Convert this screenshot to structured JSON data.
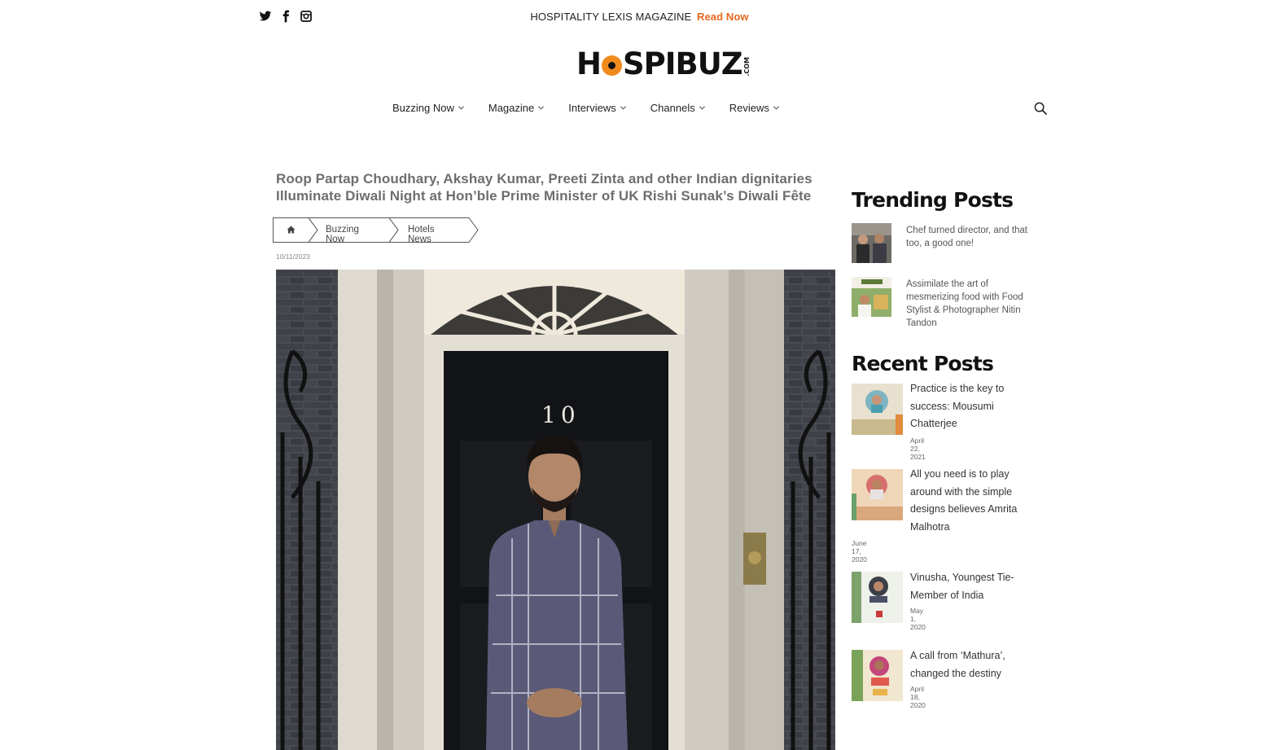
{
  "topbar": {
    "social_icons": [
      "twitter-icon",
      "facebook-icon",
      "instagram-icon"
    ],
    "promo_text": "HOSPITALITY LEXIS MAGAZINE",
    "promo_link": "Read Now"
  },
  "logo": {
    "text_before": "H",
    "text_after": "SPIBUZ",
    "suffix": ".COM"
  },
  "nav": {
    "items": [
      {
        "label": "Buzzing Now"
      },
      {
        "label": "Magazine"
      },
      {
        "label": "Interviews"
      },
      {
        "label": "Channels"
      },
      {
        "label": "Reviews"
      }
    ],
    "search_icon": "search-icon"
  },
  "article": {
    "title": "Roop Partap Choudhary, Akshay Kumar, Preeti Zinta and other Indian dignitaries Illuminate Diwali Night at Hon’ble Prime Minister of UK Rishi Sunak’s Diwali Fête",
    "breadcrumb": {
      "home_icon": "home-icon",
      "items": [
        "Buzzing Now",
        "Hotels News"
      ]
    },
    "date": "10/11/2023",
    "door_number": "10"
  },
  "sidebar": {
    "trending_title": "Trending Posts",
    "trending": [
      {
        "text": "Chef turned director, and that too, a good one!"
      },
      {
        "text": "Assimilate the art of mesmerizing food with Food Stylist & Photographer Nitin Tandon"
      }
    ],
    "recent_title": "Recent Posts",
    "recent": [
      {
        "text": "Practice is the key to success: Mousumi Chatterjee",
        "date": "April 22, 2021"
      },
      {
        "text": "All you need is to play around with the simple designs believes Amrita Malhotra",
        "date": "June 17, 2020"
      },
      {
        "text": "Vinusha, Youngest Tie-Member of India",
        "date": "May 1, 2020"
      },
      {
        "text": "A call from ‘Mathura’, changed the destiny",
        "date": "April 18, 2020"
      }
    ]
  },
  "colors": {
    "accent": "#e8671e",
    "title_grey": "#6e6e6e"
  }
}
